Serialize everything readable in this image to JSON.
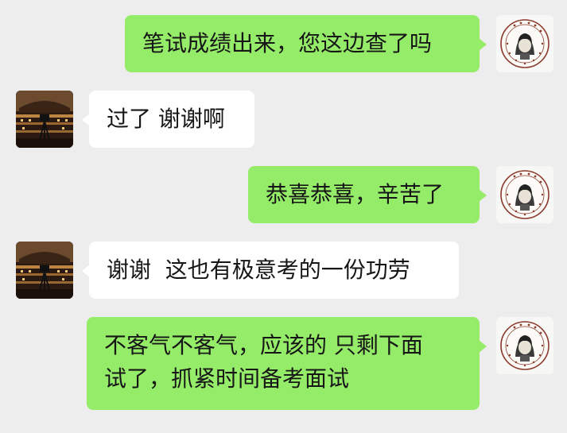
{
  "conversation": {
    "messages": [
      {
        "sender": "self",
        "avatar": "school-seal",
        "text": "笔试成绩出来，您这边查了吗"
      },
      {
        "sender": "other",
        "avatar": "dark-photo",
        "text": "过了 谢谢啊"
      },
      {
        "sender": "self",
        "avatar": "school-seal",
        "text": "恭喜恭喜，辛苦了"
      },
      {
        "sender": "other",
        "avatar": "dark-photo",
        "text": "谢谢  这也有极意考的一份功劳"
      },
      {
        "sender": "self",
        "avatar": "school-seal",
        "lines": [
          "不客气不客气，应该的 只剩下面",
          "试了，抓紧时间备考面试"
        ]
      }
    ]
  },
  "colors": {
    "background": "#ededed",
    "sent_bubble": "#95ec69",
    "received_bubble": "#ffffff",
    "text": "#161616"
  }
}
